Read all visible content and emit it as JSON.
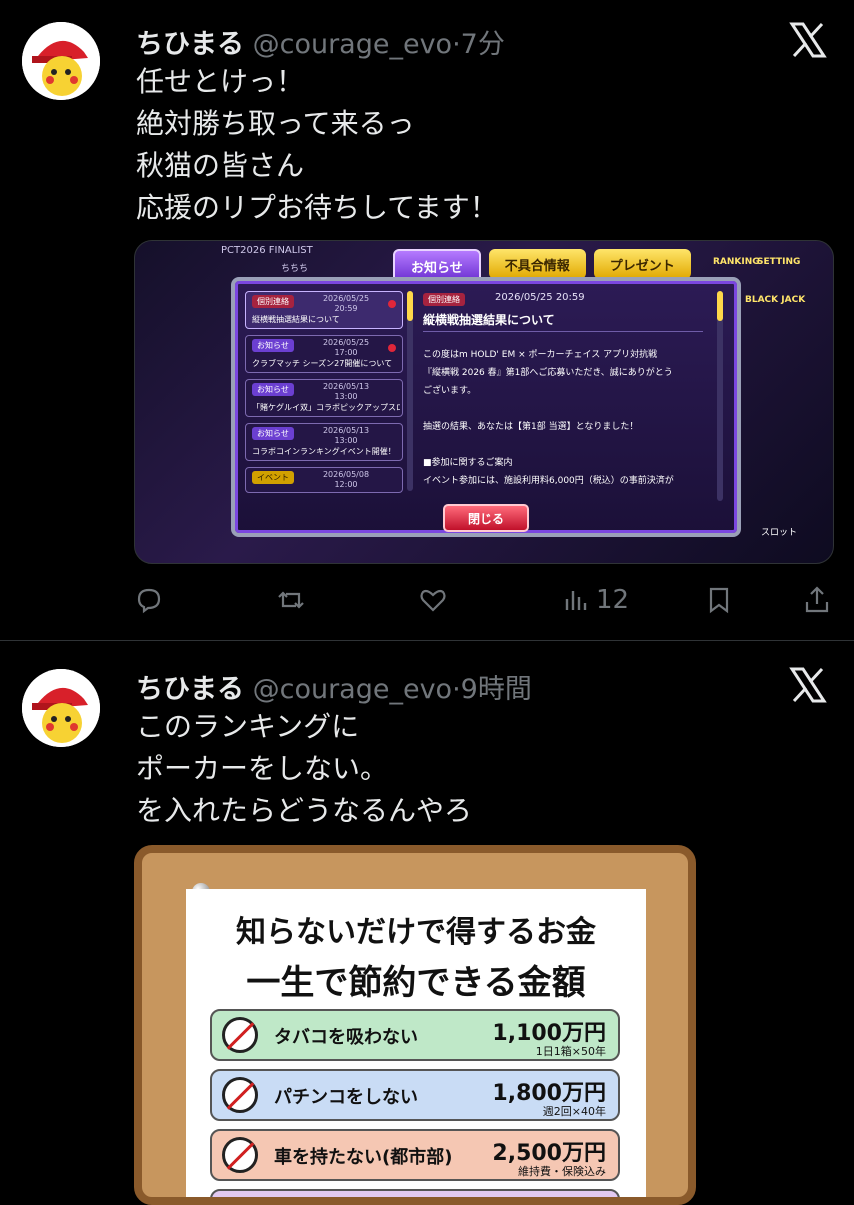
{
  "tweets": [
    {
      "name": "ちひまる",
      "handle": "@courage_evo",
      "dot": "·",
      "time": "7分",
      "lines": [
        "任せとけっ！",
        "絶対勝ち取って来るっ",
        "秋猫の皆さん",
        "応援のリプお待ちしてます！"
      ],
      "views": "12",
      "media": {
        "top_label": "PCT2026 FINALIST",
        "top_sub": "ちちち",
        "tabs": [
          "お知らせ",
          "不具合情報",
          "プレゼント"
        ],
        "side_right": [
          "RANKING",
          "SETTING",
          "BLACK JACK",
          "スロット"
        ],
        "list": [
          {
            "badge": "個別連絡",
            "date": "2026/05/25 20:59",
            "title": "縦横戦抽選結果について",
            "kind": "red"
          },
          {
            "badge": "お知らせ",
            "date": "2026/05/25 17:00",
            "title": "クラブマッチ シーズン27開催について",
            "kind": "purple"
          },
          {
            "badge": "お知らせ",
            "date": "2026/05/13 13:00",
            "title": "「賭ケグルイ双」コラボピックアップスロ...",
            "kind": "purple"
          },
          {
            "badge": "お知らせ",
            "date": "2026/05/13 13:00",
            "title": "コラボコインランキングイベント開催！",
            "kind": "purple"
          },
          {
            "badge": "イベント",
            "date": "2026/05/08 12:00",
            "title": "",
            "kind": "yellow"
          }
        ],
        "detail": {
          "badge": "個別連絡",
          "date": "2026/05/25 20:59",
          "title": "縦横戦抽選結果について",
          "lines": [
            "この度はm HOLD' EM × ポーカーチェイス アプリ対抗戦",
            "『縦横戦 2026 春』第1部へご応募いただき、誠にありがとう",
            "ございます。",
            "",
            "抽選の結果、あなたは【第1部 当選】となりました！",
            "",
            "■参加に関するご案内",
            "イベント参加には、施設利用料6,000円（税込）の事前決済が"
          ]
        },
        "close_label": "閉じる"
      }
    },
    {
      "name": "ちひまる",
      "handle": "@courage_evo",
      "dot": "·",
      "time": "9時間",
      "lines": [
        "このランキングに",
        "ポーカーをしない。",
        "を入れたらどうなるんやろ"
      ],
      "poster": {
        "title1": "知らないだけで得するお金",
        "title2": "一生で節約できる金額",
        "rows": [
          {
            "label": "タバコを吸わない",
            "amount": "1,100万円",
            "note": "1日1箱×50年",
            "color": "#bfe8c8"
          },
          {
            "label": "パチンコをしない",
            "amount": "1,800万円",
            "note": "週2回×40年",
            "color": "#c9dcf5"
          },
          {
            "label": "車を持たない(都市部)",
            "amount": "2,500万円",
            "note": "維持費・保険込み",
            "color": "#f5c7b3"
          },
          {
            "label": "",
            "amount": "",
            "note": "",
            "color": "#e2c9f0"
          }
        ]
      }
    }
  ],
  "icons": [
    "reply-icon",
    "retweet-icon",
    "like-icon",
    "views-icon",
    "bookmark-icon",
    "share-icon",
    "x-logo-icon"
  ]
}
